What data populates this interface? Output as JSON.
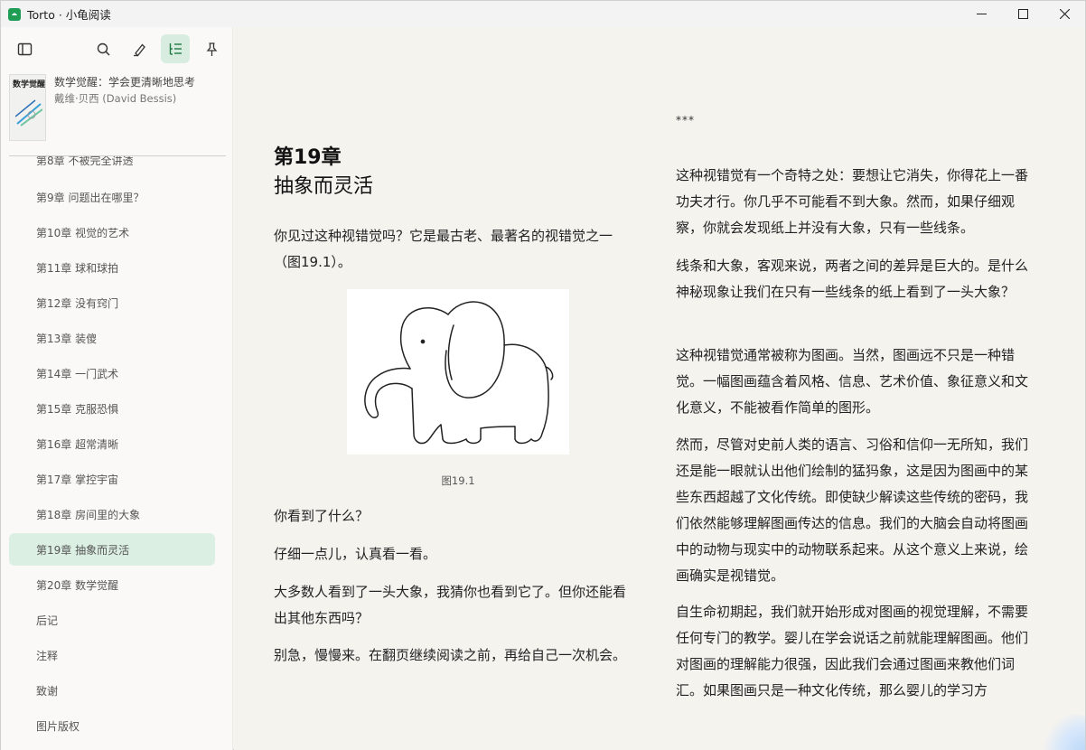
{
  "window": {
    "title": "Torto · 小龟阅读"
  },
  "sidebar": {
    "book": {
      "title": "数学觉醒：学会更清晰地思考",
      "author": "戴维·贝西 (David Bessis)",
      "cover_text": "数学觉醒"
    },
    "toc": [
      {
        "label": "第8章 不被完全讲透"
      },
      {
        "label": "第9章 问题出在哪里？"
      },
      {
        "label": "第10章 视觉的艺术"
      },
      {
        "label": "第11章 球和球拍"
      },
      {
        "label": "第12章 没有窍门"
      },
      {
        "label": "第13章 装傻"
      },
      {
        "label": "第14章 一门武术"
      },
      {
        "label": "第15章 克服恐惧"
      },
      {
        "label": "第16章 超常清晰"
      },
      {
        "label": "第17章 掌控宇宙"
      },
      {
        "label": "第18章 房间里的大象"
      },
      {
        "label": "第19章 抽象而灵活"
      },
      {
        "label": "第20章 数学觉醒"
      },
      {
        "label": "后记"
      },
      {
        "label": "注释"
      },
      {
        "label": "致谢"
      },
      {
        "label": "图片版权"
      }
    ],
    "active_index": 11
  },
  "reader": {
    "chapter_number": "第19章",
    "chapter_title": "抽象而灵活",
    "left": {
      "p1": "你见过这种视错觉吗？它是最古老、最著名的视错觉之一（图19.1）。",
      "figure_caption": "图19.1",
      "p2": "你看到了什么？",
      "p3": "仔细一点儿，认真看一看。",
      "p4": "大多数人看到了一头大象，我猜你也看到它了。但你还能看出其他东西吗？",
      "p5": "别急，慢慢来。在翻页继续阅读之前，再给自己一次机会。"
    },
    "right": {
      "separator": "***",
      "p1": "这种视错觉有一个奇特之处：要想让它消失，你得花上一番功夫才行。你几乎不可能看不到大象。然而，如果仔细观察，你就会发现纸上并没有大象，只有一些线条。",
      "p2": "线条和大象，客观来说，两者之间的差异是巨大的。是什么神秘现象让我们在只有一些线条的纸上看到了一头大象？",
      "p3": "这种视错觉通常被称为图画。当然，图画远不只是一种错觉。一幅图画蕴含着风格、信息、艺术价值、象征意义和文化意义，不能被看作简单的图形。",
      "p4": "然而，尽管对史前人类的语言、习俗和信仰一无所知，我们还是能一眼就认出他们绘制的猛犸象，这是因为图画中的某些东西超越了文化传统。即使缺少解读这些传统的密码，我们依然能够理解图画传达的信息。我们的大脑会自动将图画中的动物与现实中的动物联系起来。从这个意义上来说，绘画确实是视错觉。",
      "p5": "自生命初期起，我们就开始形成对图画的视觉理解，不需要任何专门的教学。婴儿在学会说话之前就能理解图画。他们对图画的理解能力很强，因此我们会通过图画来教他们词汇。如果图画只是一种文化传统，那么婴儿的学习方"
    }
  },
  "colors": {
    "accent": "#1f9d55",
    "active_bg": "#dcefe3",
    "page_bg": "#f5f3ee"
  }
}
